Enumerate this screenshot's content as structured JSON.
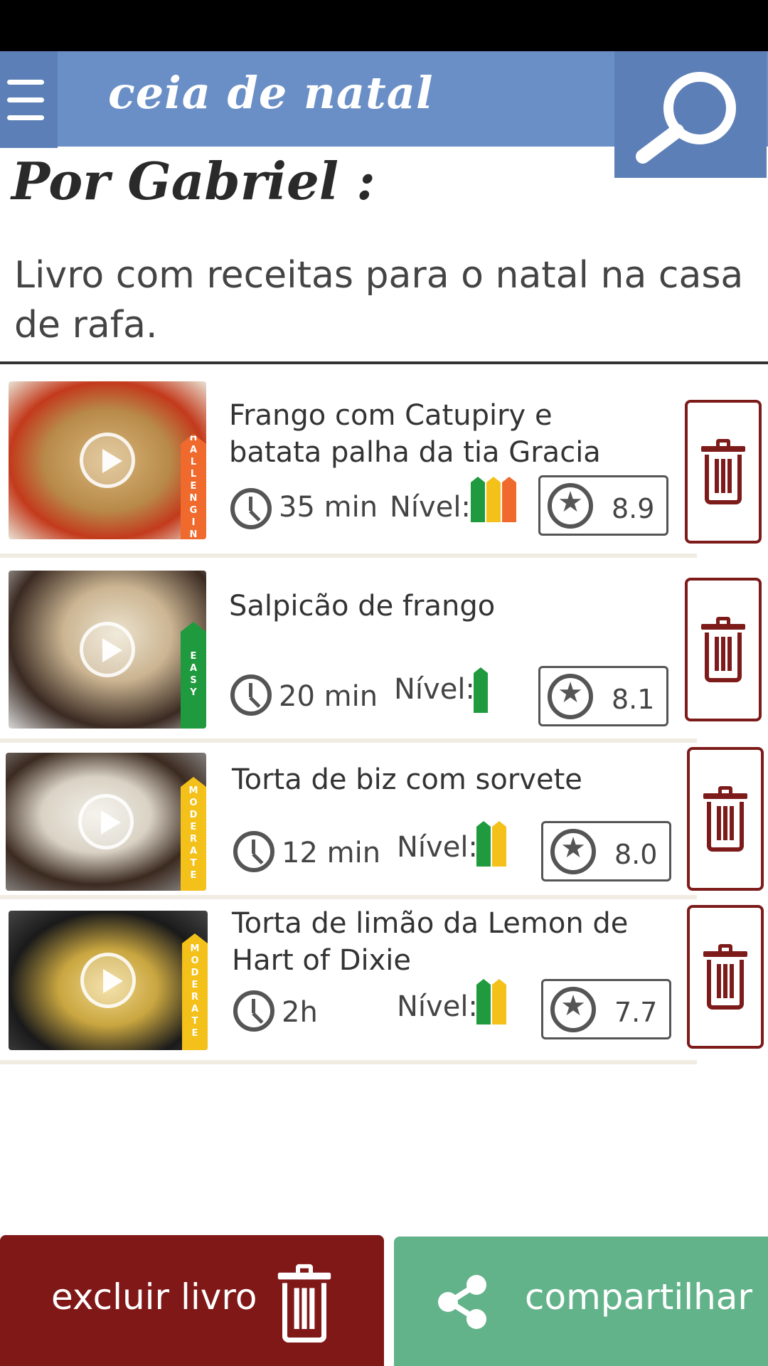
{
  "header": {
    "title": "ceia de natal"
  },
  "author": "Por Gabriel :",
  "description": "Livro com receitas para o natal na casa de  rafa.",
  "level_label": "Nível:",
  "recipes": [
    {
      "title": "Frango com Catupiry e batata palha da tia Gracia",
      "time": "35 min",
      "difficulty": "CHALLENGING",
      "difficulty_color": "#ef6a2c",
      "level_bars": [
        "EASY",
        "MODERATE",
        "CHALLENGING"
      ],
      "rating": "8.9"
    },
    {
      "title": "Salpicão de frango",
      "time": "20 min",
      "difficulty": "EASY",
      "difficulty_color": "#1f9a3e",
      "level_bars": [
        "EASY"
      ],
      "rating": "8.1"
    },
    {
      "title": "Torta de biz com sorvete",
      "time": "12 min",
      "difficulty": "MODERATE",
      "difficulty_color": "#f3c11a",
      "level_bars": [
        "EASY",
        "MODERATE"
      ],
      "rating": "8.0"
    },
    {
      "title": "Torta de limão da Lemon de Hart of Dixie",
      "time": "2h",
      "difficulty": "MODERATE",
      "difficulty_color": "#f3c11a",
      "level_bars": [
        "EASY",
        "MODERATE"
      ],
      "rating": "7.7"
    }
  ],
  "footer": {
    "delete_label": "excluir livro",
    "share_label": "compartilhar"
  },
  "colors": {
    "header": "#6a8fc6",
    "delete": "#801818",
    "share": "#63b38a"
  }
}
